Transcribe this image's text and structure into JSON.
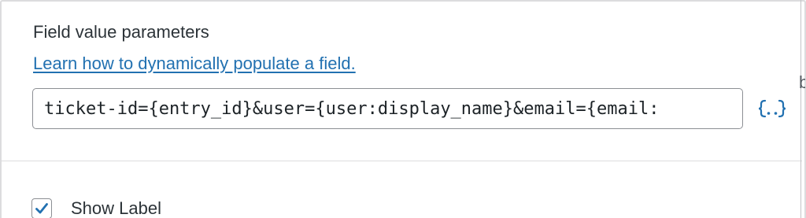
{
  "field_value_parameters": {
    "label": "Field value parameters",
    "help_link_text": "Learn how to dynamically populate a field.",
    "input_value": "ticket-id={entry_id}&user={user:display_name}&email={email:",
    "merge_tag_icon": "merge-tag-icon"
  },
  "appearance": {
    "show_label": {
      "label": "Show Label",
      "checked": true
    }
  },
  "right_edge_fragment": "b",
  "colors": {
    "link": "#2271b1",
    "text": "#2c3338",
    "border": "#8c8f94",
    "checkmark": "#2271b1",
    "merge_tag": "#2271b1"
  }
}
